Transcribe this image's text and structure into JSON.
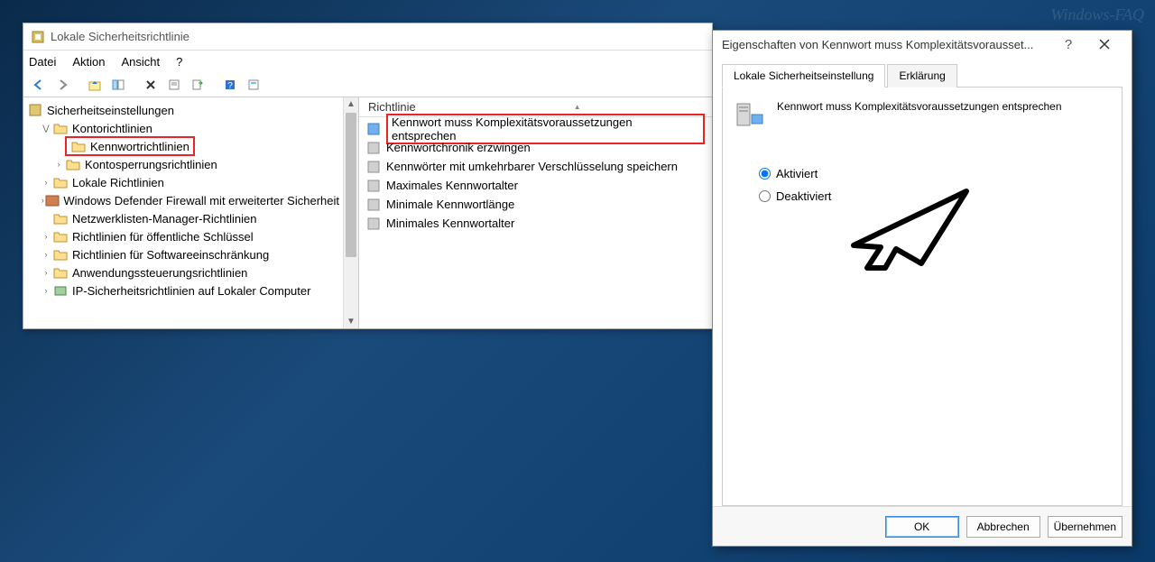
{
  "watermark": "Windows-FAQ",
  "main": {
    "title": "Lokale Sicherheitsrichtlinie",
    "menu": {
      "datei": "Datei",
      "aktion": "Aktion",
      "ansicht": "Ansicht",
      "hilfe": "?"
    },
    "tree": {
      "root": "Sicherheitseinstellungen",
      "kontorichtlinien": "Kontorichtlinien",
      "kennwortrichtlinien": "Kennwortrichtlinien",
      "kontosperrung": "Kontosperrungsrichtlinien",
      "lokale_richtlinien": "Lokale Richtlinien",
      "defender": "Windows Defender Firewall mit erweiterter Sicherheit",
      "netzwerklisten": "Netzwerklisten-Manager-Richtlinien",
      "oeffentliche": "Richtlinien für öffentliche Schlüssel",
      "softwareeinschraenkung": "Richtlinien für Softwareeinschränkung",
      "anwendungssteuerung": "Anwendungssteuerungsrichtlinien",
      "ipsicherheit": "IP-Sicherheitsrichtlinien auf Lokaler Computer"
    },
    "list": {
      "header": "Richtlinie",
      "items": [
        "Kennwort muss Komplexitätsvoraussetzungen entsprechen",
        "Kennwortchronik erzwingen",
        "Kennwörter mit umkehrbarer Verschlüsselung speichern",
        "Maximales Kennwortalter",
        "Minimale Kennwortlänge",
        "Minimales Kennwortalter"
      ]
    }
  },
  "dialog": {
    "title": "Eigenschaften von Kennwort muss Komplexitätsvorausset...",
    "tabs": {
      "lokale": "Lokale Sicherheitseinstellung",
      "erklaerung": "Erklärung"
    },
    "policy_name": "Kennwort muss Komplexitätsvoraussetzungen entsprechen",
    "radio": {
      "aktiviert": "Aktiviert",
      "deaktiviert": "Deaktiviert",
      "selected": "aktiviert"
    },
    "buttons": {
      "ok": "OK",
      "abbrechen": "Abbrechen",
      "uebernehmen": "Übernehmen"
    }
  }
}
